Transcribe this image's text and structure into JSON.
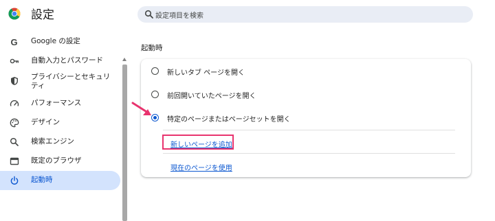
{
  "header": {
    "app_title": "設定",
    "logo_icon": "chrome-logo",
    "search": {
      "placeholder": "設定項目を検索",
      "icon": "search-icon"
    }
  },
  "sidebar": {
    "items": [
      {
        "label": "Google の設定",
        "icon": "google-g-icon",
        "active": false
      },
      {
        "label": "自動入力とパスワード",
        "icon": "key-icon",
        "active": false
      },
      {
        "label": "プライバシーとセキュリティ",
        "icon": "shield-icon",
        "active": false
      },
      {
        "label": "パフォーマンス",
        "icon": "speedometer-icon",
        "active": false
      },
      {
        "label": "デザイン",
        "icon": "palette-icon",
        "active": false
      },
      {
        "label": "検索エンジン",
        "icon": "search-icon",
        "active": false
      },
      {
        "label": "既定のブラウザ",
        "icon": "browser-window-icon",
        "active": false
      },
      {
        "label": "起動時",
        "icon": "power-icon",
        "active": true
      }
    ]
  },
  "main": {
    "section_title": "起動時",
    "options": [
      {
        "label": "新しいタブ ページを開く",
        "selected": false
      },
      {
        "label": "前回開いていたページを開く",
        "selected": false
      },
      {
        "label": "特定のページまたはページセットを開く",
        "selected": true
      }
    ],
    "add_page_link": "新しいページを追加",
    "use_current_link": "現在のページを使用"
  },
  "colors": {
    "accent": "#0b57d0",
    "active_nav_bg": "#d3e3fd",
    "annotation": "#e8336e"
  }
}
